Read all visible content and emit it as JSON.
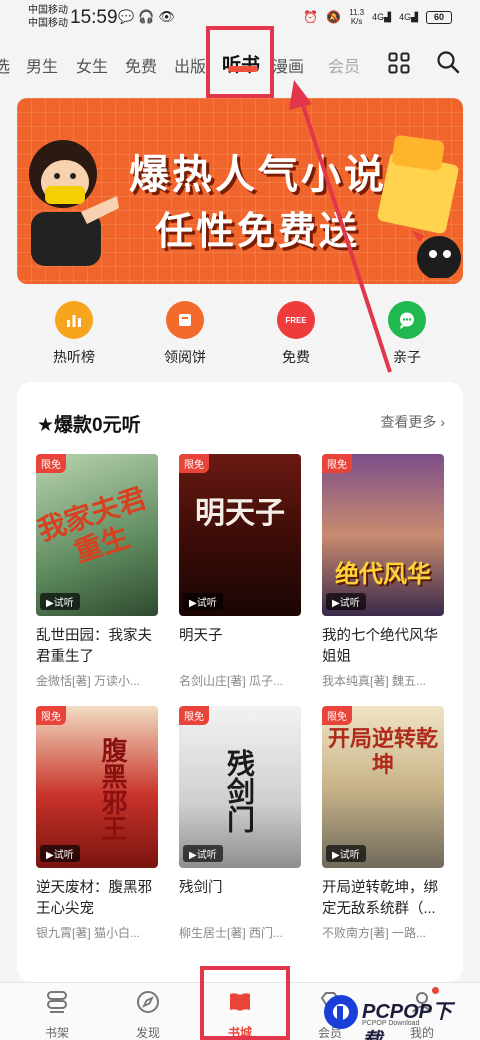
{
  "status_bar": {
    "carrier1": "中国移动",
    "carrier2": "中国移动",
    "time": "15:59",
    "net_speed_value": "11.3",
    "net_speed_unit": "K/s",
    "signal1": "4G",
    "signal2": "4G",
    "battery": "60"
  },
  "nav_tabs": [
    {
      "label": "选"
    },
    {
      "label": "男生"
    },
    {
      "label": "女生"
    },
    {
      "label": "免费"
    },
    {
      "label": "出版"
    },
    {
      "label": "听书"
    },
    {
      "label": "漫画"
    },
    {
      "label": "会员"
    }
  ],
  "banner": {
    "title": "爆热人气小说",
    "subtitle": "任性免费送"
  },
  "quick_links": [
    {
      "label": "热听榜",
      "icon": "bar-chart-icon",
      "color": "#f7a51c"
    },
    {
      "label": "领阅饼",
      "icon": "coupon-icon",
      "color": "#f36a2b"
    },
    {
      "label": "免费",
      "icon": "free-icon",
      "color": "#ee3b3b",
      "icon_text": "FREE"
    },
    {
      "label": "亲子",
      "icon": "chat-bubble-icon",
      "color": "#1fb94f"
    }
  ],
  "section": {
    "title": "★爆款0元听",
    "see_more": "查看更多"
  },
  "books": [
    {
      "title": "乱世田园：我家夫君重生了",
      "author": "金微恬[著] 万读小...",
      "badge": "限免",
      "listen": "试听",
      "cover_text": "我家夫君重生"
    },
    {
      "title": "明天子",
      "author": "名剑山庄[著] 瓜子...",
      "badge": "限免",
      "listen": "试听",
      "cover_text": "明天子"
    },
    {
      "title": "我的七个绝代风华姐姐",
      "author": "我本纯真[著] 魏五...",
      "badge": "限免",
      "listen": "试听",
      "cover_text": "绝代风华"
    },
    {
      "title": "逆天废材：腹黑邪王心尖宠",
      "author": "银九霄[著] 猫小白...",
      "badge": "限免",
      "listen": "试听",
      "cover_text": "腹黑邪王"
    },
    {
      "title": "残剑门",
      "author": "柳生居士[著] 西门...",
      "badge": "限免",
      "listen": "试听",
      "cover_text": "残剑门"
    },
    {
      "title": "开局逆转乾坤，绑定无敌系统群（...",
      "author": "不败南方[著] 一路...",
      "badge": "限免",
      "listen": "试听",
      "cover_text": "开局逆转乾坤"
    }
  ],
  "bottom_nav": [
    {
      "label": "书架"
    },
    {
      "label": "发现"
    },
    {
      "label": "书城"
    },
    {
      "label": "会员"
    },
    {
      "label": "我的"
    }
  ],
  "watermark": {
    "text": "PCPOP下载",
    "small": "PCPOP Download"
  },
  "colors": {
    "accent": "#e8443a",
    "highlight": "#e2364a",
    "banner": "#f0652c"
  }
}
